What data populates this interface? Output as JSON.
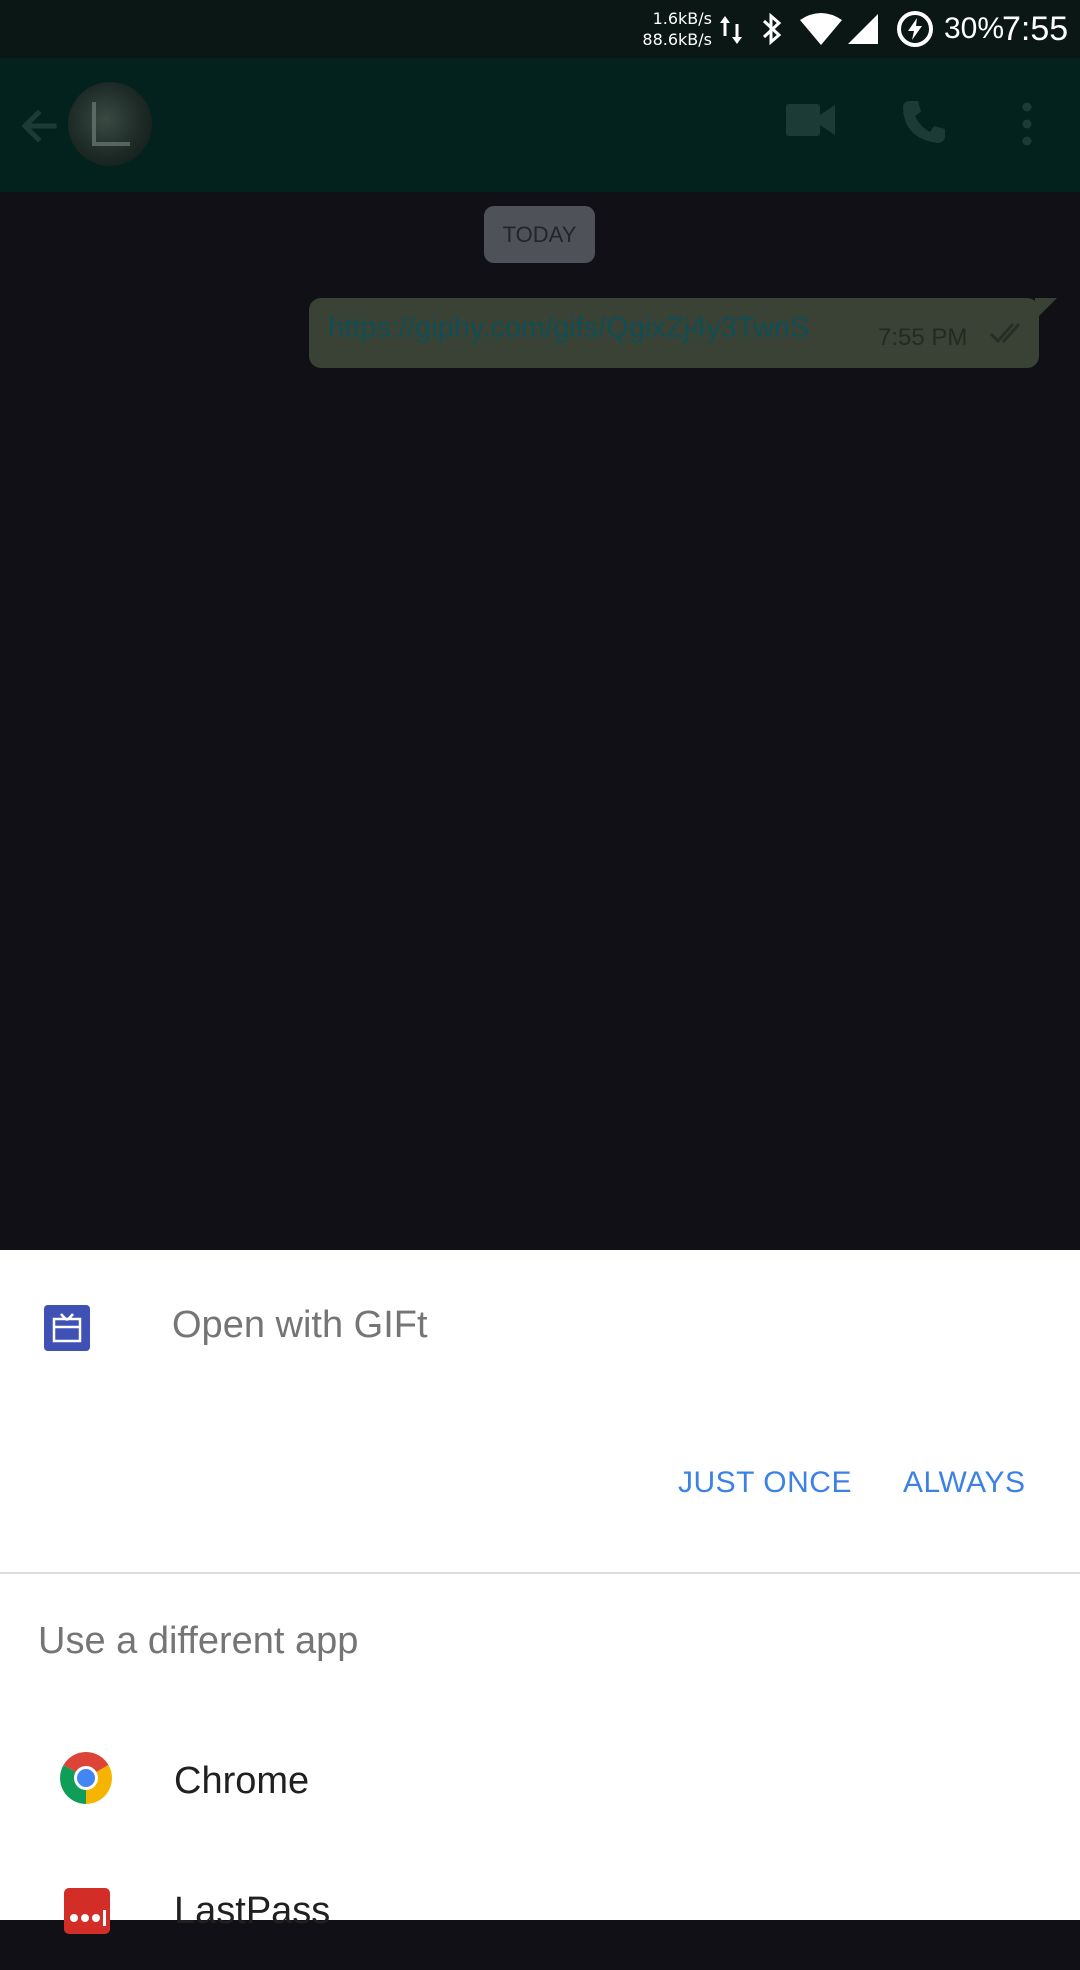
{
  "status_bar": {
    "upload_speed": "1.6kB/s",
    "download_speed": "88.6kB/s",
    "battery": "30%",
    "time": "7:55"
  },
  "header": {
    "icons": [
      "back-arrow-icon",
      "avatar",
      "video-call-icon",
      "phone-icon",
      "more-vert-icon"
    ]
  },
  "chat": {
    "date_label": "TODAY",
    "message": {
      "text": "https://giphy.com/gifs/QgixZj4y3TwnS",
      "time": "7:55 PM"
    }
  },
  "dialog": {
    "title": "Open with GIFt",
    "just_once": "JUST ONCE",
    "always": "ALWAYS",
    "different_app_label": "Use a different app",
    "apps": [
      {
        "name": "Chrome",
        "icon": "chrome-icon"
      },
      {
        "name": "LastPass",
        "icon": "lastpass-icon"
      }
    ]
  },
  "colors": {
    "accent": "#3b82e4",
    "header_bg": "#03211d",
    "chat_bg": "#111016",
    "bubble_bg": "#3a4236"
  }
}
